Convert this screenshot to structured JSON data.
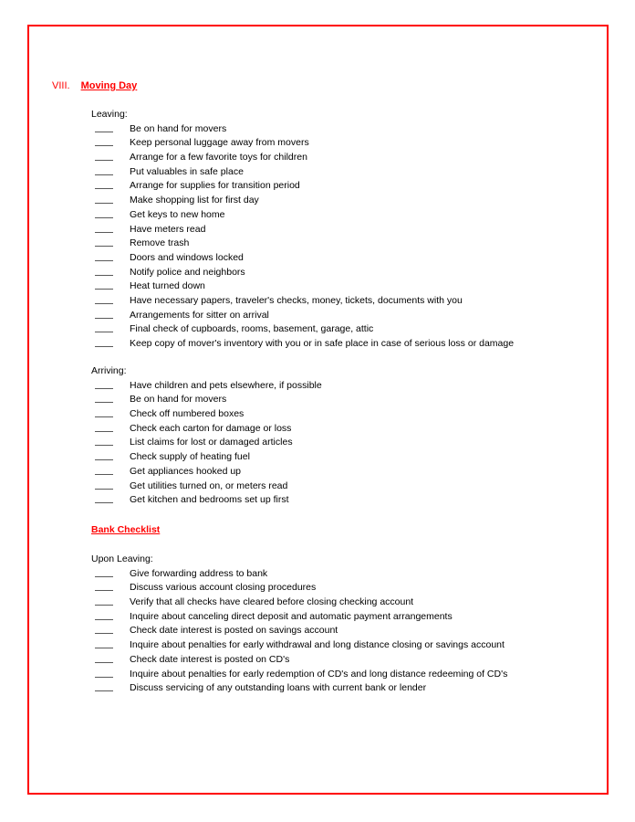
{
  "document": {
    "border_color": "#ff0000",
    "accent_color": "#ff0000",
    "text_color": "#000000",
    "blank_mark": "___"
  },
  "section": {
    "number": "VIII.",
    "title": "Moving Day"
  },
  "groups": [
    {
      "label": "Leaving:",
      "items": [
        "Be on hand for movers",
        "Keep personal luggage away from movers",
        "Arrange for a few favorite toys for children",
        "Put valuables in safe place",
        "Arrange for supplies for transition period",
        "Make shopping list for first day",
        "Get keys to new home",
        "Have meters read",
        "Remove trash",
        "Doors and windows locked",
        "Notify police and neighbors",
        "Heat turned down",
        "Have necessary papers, traveler's checks, money, tickets, documents with you",
        "Arrangements for sitter on arrival",
        "Final check of cupboards, rooms, basement, garage, attic",
        "Keep copy of mover's inventory with you or in safe place in case of serious loss or damage"
      ]
    },
    {
      "label": "Arriving:",
      "items": [
        "Have children and pets elsewhere, if possible",
        "Be on hand for movers",
        "Check off numbered boxes",
        "Check each carton for damage or loss",
        "List claims for lost or damaged articles",
        "Check supply of heating fuel",
        "Get appliances hooked up",
        "Get utilities turned on, or meters read",
        "Get kitchen and bedrooms set up first"
      ]
    }
  ],
  "bank_checklist": {
    "heading": "Bank Checklist",
    "group": {
      "label": "Upon Leaving:",
      "items": [
        "Give forwarding address to bank",
        "Discuss various account closing procedures",
        "Verify that all checks have cleared before closing checking account",
        "Inquire about canceling direct deposit and automatic payment arrangements",
        "Check date interest is posted on savings account",
        "Inquire about penalties for early withdrawal and long distance closing or savings account",
        "Check date interest is posted on CD's",
        "Inquire about penalties for early redemption of CD's and long distance redeeming of CD's",
        "Discuss servicing of any outstanding loans with current bank or lender"
      ]
    }
  }
}
